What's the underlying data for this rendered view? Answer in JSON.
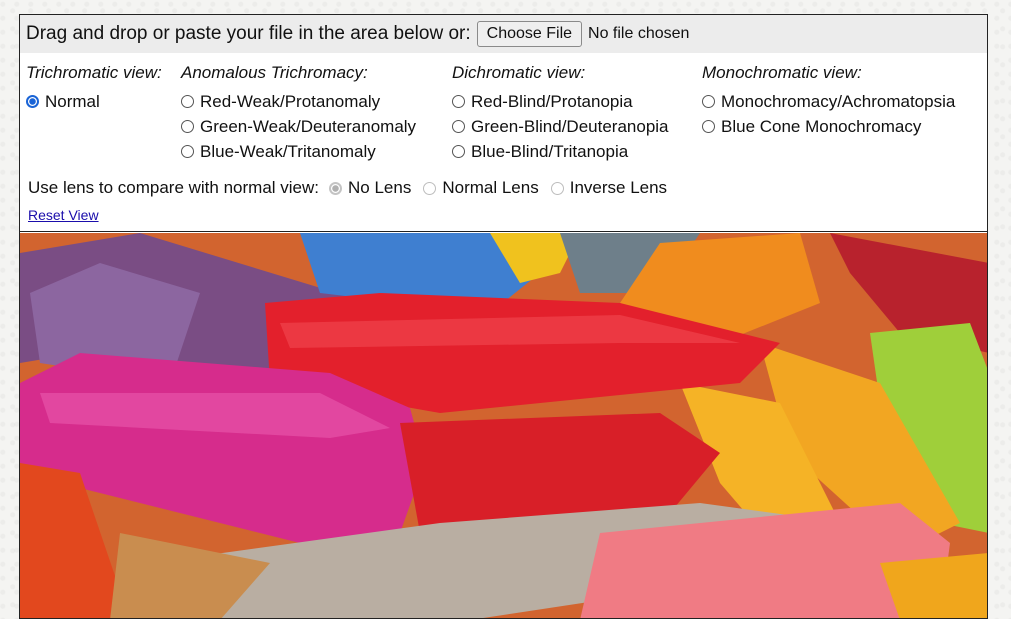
{
  "upload": {
    "prompt": "Drag and drop or paste your file in the area below or:",
    "button_label": "Choose File",
    "status": "No file chosen"
  },
  "views": {
    "trichromatic": {
      "heading": "Trichromatic view:",
      "options": [
        {
          "label": "Normal",
          "checked": true
        }
      ]
    },
    "anomalous": {
      "heading": "Anomalous Trichromacy:",
      "options": [
        {
          "label": "Red-Weak/Protanomaly",
          "checked": false
        },
        {
          "label": "Green-Weak/Deuteranomaly",
          "checked": false
        },
        {
          "label": "Blue-Weak/Tritanomaly",
          "checked": false
        }
      ]
    },
    "dichromatic": {
      "heading": "Dichromatic view:",
      "options": [
        {
          "label": "Red-Blind/Protanopia",
          "checked": false
        },
        {
          "label": "Green-Blind/Deuteranopia",
          "checked": false
        },
        {
          "label": "Blue-Blind/Tritanopia",
          "checked": false
        }
      ]
    },
    "monochromatic": {
      "heading": "Monochromatic view:",
      "options": [
        {
          "label": "Monochromacy/Achromatopsia",
          "checked": false
        },
        {
          "label": "Blue Cone Monochromacy",
          "checked": false
        }
      ]
    }
  },
  "lens": {
    "label": "Use lens to compare with normal view:",
    "options": [
      {
        "label": "No Lens",
        "checked": true,
        "disabled": true
      },
      {
        "label": "Normal Lens",
        "checked": false,
        "disabled": true
      },
      {
        "label": "Inverse Lens",
        "checked": false,
        "disabled": true
      }
    ]
  },
  "reset_label": "Reset View",
  "image": {
    "subject": "crayons-photo"
  }
}
